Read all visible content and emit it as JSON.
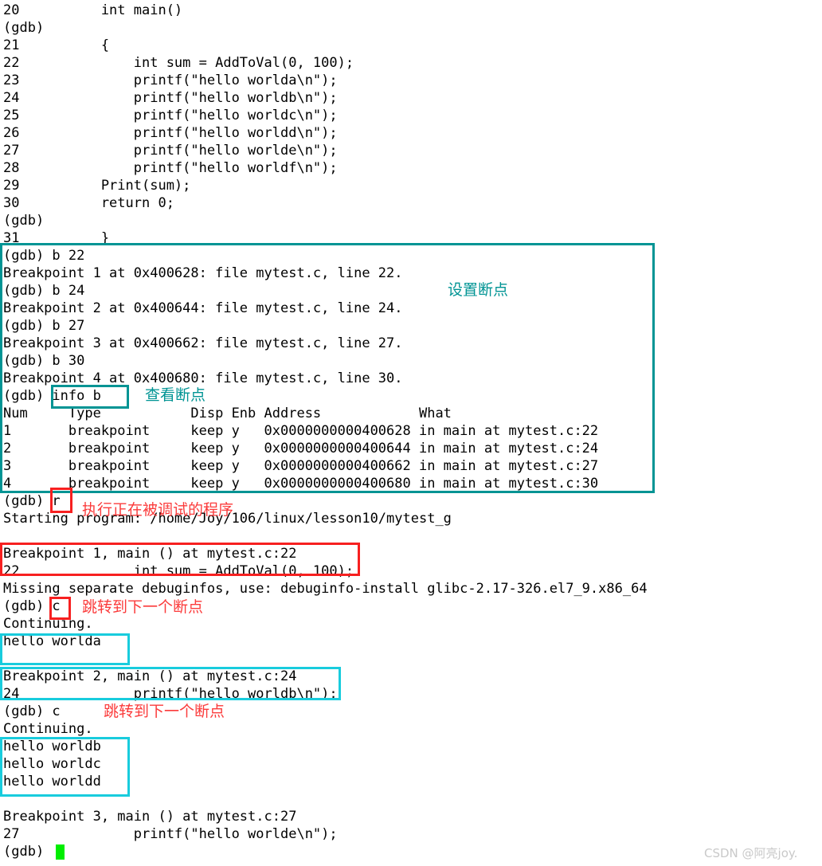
{
  "terminal": {
    "prompt": "(gdb)",
    "lines": [
      "20          int main()",
      "(gdb)",
      "21          {",
      "22              int sum = AddToVal(0, 100);",
      "23              printf(\"hello worlda\\n\");",
      "24              printf(\"hello worldb\\n\");",
      "25              printf(\"hello worldc\\n\");",
      "26              printf(\"hello worldd\\n\");",
      "27              printf(\"hello worlde\\n\");",
      "28              printf(\"hello worldf\\n\");",
      "29          Print(sum);",
      "30          return 0;",
      "(gdb)",
      "31          }",
      "(gdb) b 22",
      "Breakpoint 1 at 0x400628: file mytest.c, line 22.",
      "(gdb) b 24",
      "Breakpoint 2 at 0x400644: file mytest.c, line 24.",
      "(gdb) b 27",
      "Breakpoint 3 at 0x400662: file mytest.c, line 27.",
      "(gdb) b 30",
      "Breakpoint 4 at 0x400680: file mytest.c, line 30.",
      "(gdb) info b",
      "Num     Type           Disp Enb Address            What",
      "1       breakpoint     keep y   0x0000000000400628 in main at mytest.c:22",
      "2       breakpoint     keep y   0x0000000000400644 in main at mytest.c:24",
      "3       breakpoint     keep y   0x0000000000400662 in main at mytest.c:27",
      "4       breakpoint     keep y   0x0000000000400680 in main at mytest.c:30",
      "(gdb) r",
      "Starting program: /home/Joy/106/linux/lesson10/mytest_g",
      "",
      "Breakpoint 1, main () at mytest.c:22",
      "22              int sum = AddToVal(0, 100);",
      "Missing separate debuginfos, use: debuginfo-install glibc-2.17-326.el7_9.x86_64",
      "(gdb) c",
      "Continuing.",
      "hello worlda",
      "",
      "Breakpoint 2, main () at mytest.c:24",
      "24              printf(\"hello worldb\\n\");",
      "(gdb) c",
      "Continuing.",
      "hello worldb",
      "hello worldc",
      "hello worldd",
      "",
      "Breakpoint 3, main () at mytest.c:27",
      "27              printf(\"hello worlde\\n\");",
      "(gdb)"
    ]
  },
  "annotations": {
    "set_breakpoints": "设置断点",
    "view_breakpoints": "查看断点",
    "run_program": "执行正在被调试的程序",
    "continue_1": "跳转到下一个断点",
    "continue_2": "跳转到下一个断点"
  },
  "colors": {
    "teal": "#009494",
    "cyan": "#18ccdd",
    "red": "#f72020",
    "note_red": "#fb3b3b",
    "cursor_green": "#00ee00",
    "text": "#000000"
  },
  "watermark": {
    "text": "CSDN @阿亮joy."
  }
}
